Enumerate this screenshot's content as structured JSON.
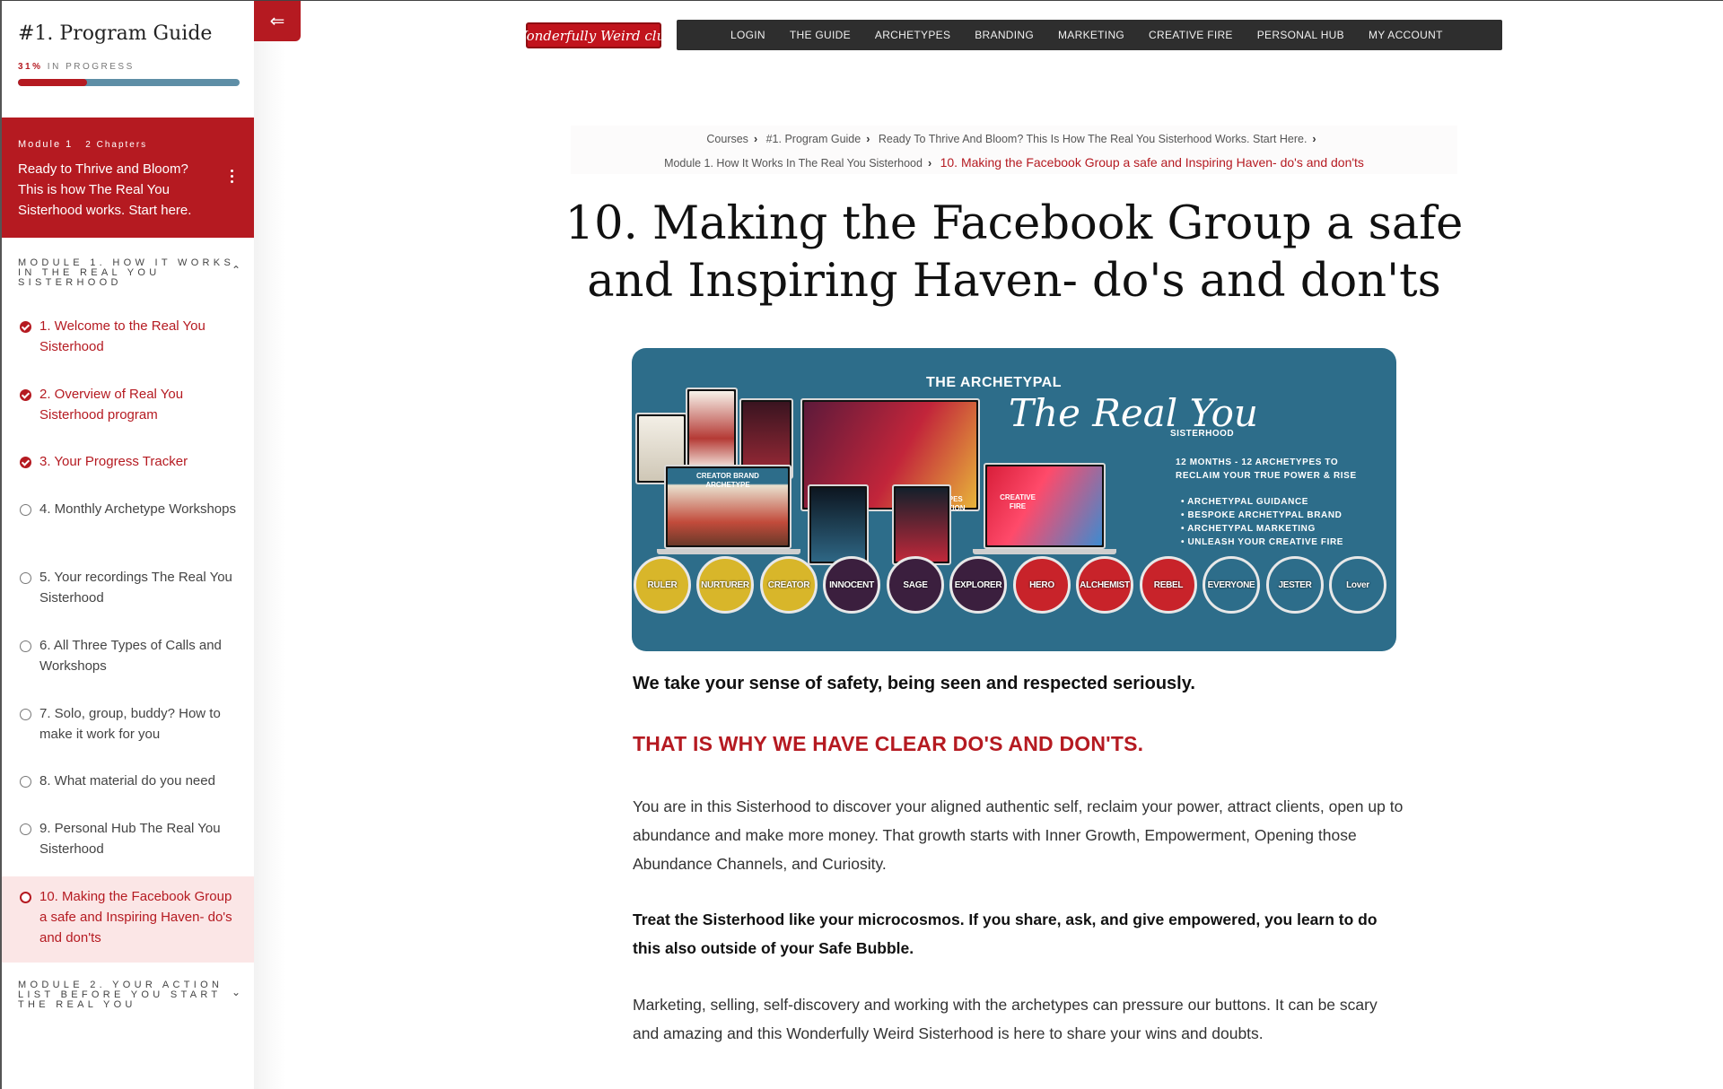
{
  "sidebar": {
    "collapse_icon": "⇐",
    "course_title": "#1. Program Guide",
    "progress": {
      "percent_label": "31%",
      "status_label": "IN PROGRESS",
      "value": 0.31
    },
    "module_card": {
      "module_label": "Module 1",
      "chapters_label": "2 Chapters",
      "description": "Ready to Thrive and Bloom? This is how The Real You Sisterhood works. Start here."
    },
    "section1_title": "MODULE 1. HOW IT WORKS IN THE REAL YOU SISTERHOOD",
    "section2_title": "MODULE 2. YOUR ACTION LIST BEFORE YOU START THE REAL YOU",
    "lessons": [
      {
        "label": "1. Welcome to the Real You Sisterhood",
        "status": "complete"
      },
      {
        "label": "2. Overview of Real You Sisterhood program",
        "status": "complete"
      },
      {
        "label": "3. Your Progress Tracker",
        "status": "complete"
      },
      {
        "label": "4. Monthly Archetype Workshops",
        "status": "incomplete"
      },
      {
        "label": "5. Your recordings The Real You Sisterhood",
        "status": "incomplete"
      },
      {
        "label": "6. All Three Types of Calls and Workshops",
        "status": "incomplete"
      },
      {
        "label": "7. Solo, group, buddy? How to make it work for you",
        "status": "incomplete"
      },
      {
        "label": "8. What material do you need",
        "status": "incomplete"
      },
      {
        "label": "9. Personal Hub The Real You Sisterhood",
        "status": "incomplete"
      },
      {
        "label": "10. Making the Facebook Group a safe and Inspiring Haven- do's and don'ts",
        "status": "current"
      }
    ]
  },
  "header": {
    "logo_text": "Wonderfully Weird club",
    "nav": [
      "LOGIN",
      "THE GUIDE",
      "ARCHETYPES",
      "BRANDING",
      "MARKETING",
      "CREATIVE FIRE",
      "PERSONAL HUB",
      "MY ACCOUNT"
    ]
  },
  "breadcrumb": {
    "items": [
      "Courses",
      "#1. Program Guide",
      "Ready To Thrive And Bloom? This Is How The Real You Sisterhood Works. Start Here.",
      "Module 1. How It Works In The Real You Sisterhood"
    ],
    "current": "10. Making the Facebook Group a safe and Inspiring Haven- do's and don'ts"
  },
  "page_title": "10. Making the Facebook Group a safe and Inspiring Haven- do's and don'ts",
  "banner": {
    "title": "THE ARCHETYPAL",
    "script_title": "The Real You",
    "subtitle": "SISTERHOOD",
    "tagline_1": "12 MONTHS - 12 ARCHETYPES TO",
    "tagline_2": "RECLAIM YOUR TRUE POWER & RISE",
    "bullets": [
      "ARCHETYPAL GUIDANCE",
      "BESPOKE ARCHETYPAL BRAND",
      "ARCHETYPAL MARKETING",
      "UNLEASH YOUR CREATIVE FIRE"
    ],
    "device_labels": [
      "CREATOR BRAND ARCHETYPE",
      "12 ARCHETYPES THE FOUNDATION",
      "CREATIVE FIRE"
    ],
    "archetypes": [
      {
        "label": "RULER",
        "color": "#d8b62a"
      },
      {
        "label": "NURTURER",
        "color": "#d8b62a"
      },
      {
        "label": "CREATOR",
        "color": "#d8b62a"
      },
      {
        "label": "INNOCENT",
        "color": "#3b1f3e"
      },
      {
        "label": "SAGE",
        "color": "#3b1f3e"
      },
      {
        "label": "EXPLORER",
        "color": "#3b1f3e"
      },
      {
        "label": "HERO",
        "color": "#c8232a"
      },
      {
        "label": "ALCHEMIST",
        "color": "#c8232a"
      },
      {
        "label": "REBEL",
        "color": "#c8232a"
      },
      {
        "label": "EVERYONE",
        "color": "#2d6d8a"
      },
      {
        "label": "JESTER",
        "color": "#2d6d8a"
      },
      {
        "label": "Lover",
        "color": "#2d6d8a"
      }
    ]
  },
  "content": {
    "lead": "We take your sense of safety, being seen and respected seriously.",
    "subhead": "THAT IS WHY WE HAVE CLEAR DO'S AND DON'TS.",
    "para1": "You are in this Sisterhood to discover your aligned authentic self, reclaim your power, attract clients, open up to abundance and make more money. That growth starts with Inner Growth, Empowerment, Opening those Abundance Channels, and Curiosity.",
    "para2": "Treat the Sisterhood like your microcosmos. If you share, ask, and give empowered, you learn to do this also outside of your Safe Bubble.",
    "para3": "Marketing, selling, self-discovery and working with the archetypes can pressure our buttons. It can be scary and amazing and this Wonderfully Weird Sisterhood is here to share your wins and doubts."
  },
  "colors": {
    "accent": "#b51a21",
    "banner_bg": "#2d6d8a",
    "nav_bg": "#2e2e2e",
    "progress_track": "#5e8ea6"
  }
}
